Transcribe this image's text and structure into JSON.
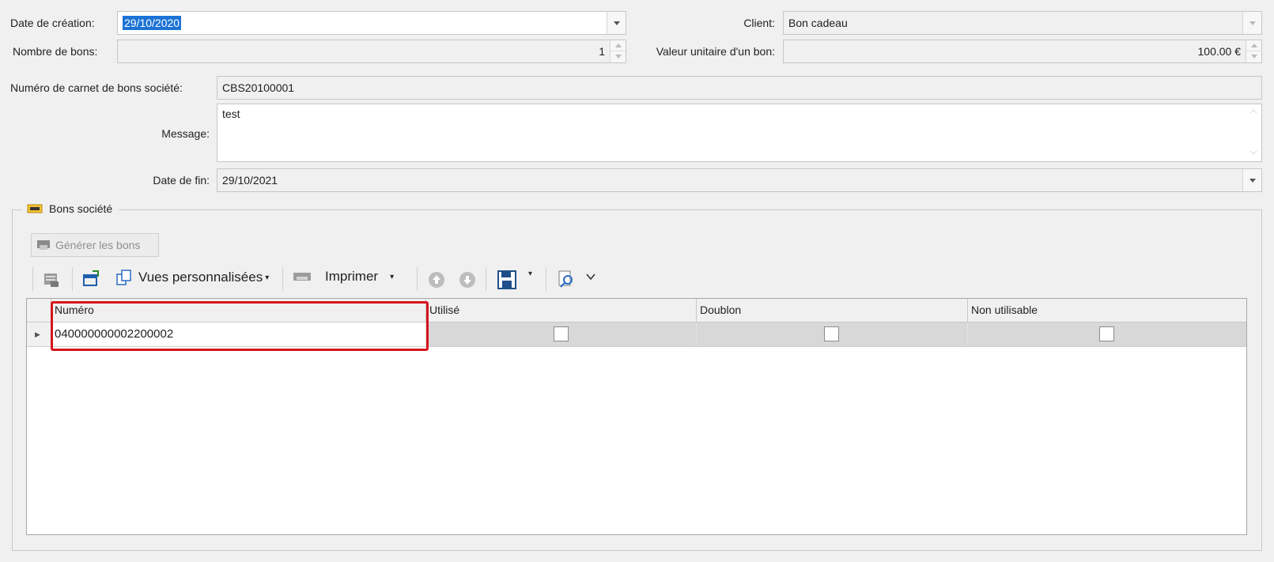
{
  "form": {
    "date_creation": {
      "label": "Date de création:",
      "value": "29/10/2020"
    },
    "client": {
      "label": "Client:",
      "value": "Bon cadeau"
    },
    "nombre_bons": {
      "label": "Nombre de bons:",
      "value": "1"
    },
    "valeur_unitaire": {
      "label": "Valeur unitaire d'un bon:",
      "value": "100.00 €"
    },
    "numero_carnet": {
      "label": "Numéro de carnet de bons société:",
      "value": "CBS20100001"
    },
    "message": {
      "label": "Message:",
      "value": "test"
    },
    "date_fin": {
      "label": "Date de fin:",
      "value": "29/10/2021"
    }
  },
  "group": {
    "title": "Bons société",
    "generate_button": "Générer les bons"
  },
  "toolbar": {
    "custom_views": "Vues personnalisées",
    "print": "Imprimer"
  },
  "grid": {
    "columns": [
      "Numéro",
      "Utilisé",
      "Doublon",
      "Non utilisable"
    ],
    "rows": [
      {
        "numero": "040000000002200002",
        "utilise": false,
        "doublon": false,
        "non_utilisable": false
      }
    ]
  },
  "icons": [
    "gift-card-icon",
    "table-icon",
    "export-icon",
    "copy-views-icon",
    "printer-icon",
    "arrow-up-circle-icon",
    "arrow-down-circle-icon",
    "save-icon",
    "search-document-icon",
    "chevron-down-icon"
  ],
  "colors": {
    "selection": "#1c73d6",
    "highlight_box": "#d6141e",
    "selected_row": "#d8d8d8"
  }
}
